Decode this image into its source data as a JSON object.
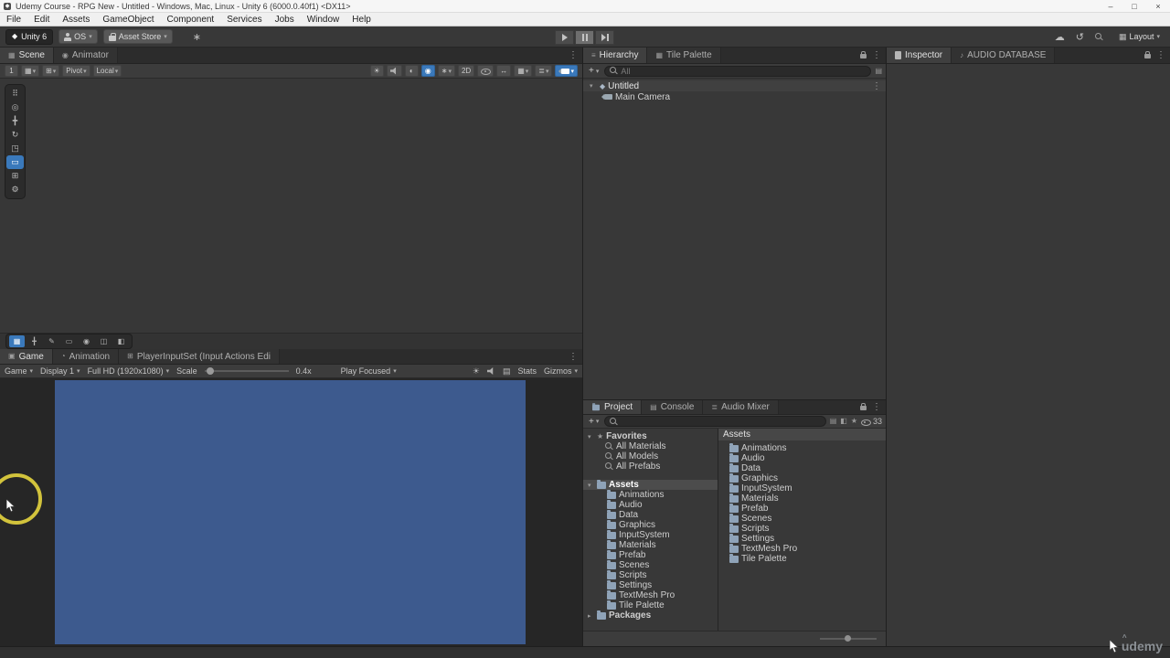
{
  "window": {
    "title": "Udemy Course - RPG New - Untitled - Windows, Mac, Linux - Unity 6 (6000.0.40f1) <DX11>",
    "minimize": "–",
    "maximize": "□",
    "close": "×"
  },
  "menubar": {
    "items": [
      "File",
      "Edit",
      "Assets",
      "GameObject",
      "Component",
      "Services",
      "Jobs",
      "Window",
      "Help"
    ]
  },
  "toolbar": {
    "unity_badge": "Unity 6",
    "account_label": "OS",
    "asset_store_label": "Asset Store",
    "layout_label": "Layout"
  },
  "scene": {
    "tabs": [
      "Scene",
      "Animator"
    ],
    "grid_size": "1",
    "pivot_label": "Pivot",
    "space_label": "Local",
    "mode_2d": "2D"
  },
  "game": {
    "tabs": [
      "Game",
      "Animation",
      "PlayerInputSet (Input Actions Edi"
    ],
    "target": "Game",
    "display": "Display 1",
    "resolution": "Full HD (1920x1080)",
    "scale_label": "Scale",
    "scale_value": "0.4x",
    "focus_mode": "Play Focused",
    "stats_label": "Stats",
    "gizmos_label": "Gizmos"
  },
  "hierarchy": {
    "tabs": [
      "Hierarchy",
      "Tile Palette"
    ],
    "search_placeholder": "All",
    "scene_name": "Untitled",
    "objects": [
      "Main Camera"
    ]
  },
  "inspector": {
    "tabs": [
      "Inspector",
      "AUDIO DATABASE"
    ]
  },
  "project": {
    "tabs": [
      "Project",
      "Console",
      "Audio Mixer"
    ],
    "hidden_count": "33",
    "favorites_label": "Favorites",
    "favorites": [
      "All Materials",
      "All Models",
      "All Prefabs"
    ],
    "assets_label": "Assets",
    "folders": [
      "Animations",
      "Audio",
      "Data",
      "Graphics",
      "InputSystem",
      "Materials",
      "Prefab",
      "Scenes",
      "Scripts",
      "Settings",
      "TextMesh Pro",
      "Tile Palette"
    ],
    "packages_label": "Packages",
    "list_header": "Assets"
  },
  "watermark": "udemy",
  "colors": {
    "selection_blue": "#3a79bb",
    "camera_background": "#3d5a8e",
    "highlight_ring": "#d2c33c"
  },
  "icons": {
    "unity_logo": "◆",
    "dropdown": "▾",
    "foldout_open": "▾",
    "foldout_closed": "▸",
    "menu_dots": "⋮",
    "cloud": "☁",
    "history": "↺",
    "grid": "▦",
    "plus": "+",
    "star": "★",
    "asterisk": "∗",
    "tools_handle": "⠿",
    "view_tool": "◎",
    "move_tool": "╋",
    "rotate_tool": "↻",
    "scale_tool": "◳",
    "rect_tool": "▭",
    "transform_tool": "⊞",
    "custom_tool": "⚙",
    "sun": "☀",
    "sphere": "◐",
    "circle": "◉",
    "layers": "≣",
    "measure": "↔",
    "snap": "⊞",
    "scene_tab": "▦",
    "animator_tab": "◉",
    "game_tab": "▣",
    "animation_tab": "◔",
    "input_tab": "⊞",
    "hierarchy_tab": "≡",
    "tile_palette_tab": "▦",
    "console_tab": "▤",
    "mixer_tab": "≣",
    "audio_db_tab": "♪",
    "select_tool": "▦",
    "brush_tool": "✎",
    "eraser_tool": "◫",
    "fill_tool": "◧",
    "label": "◧",
    "rows": "▤"
  }
}
